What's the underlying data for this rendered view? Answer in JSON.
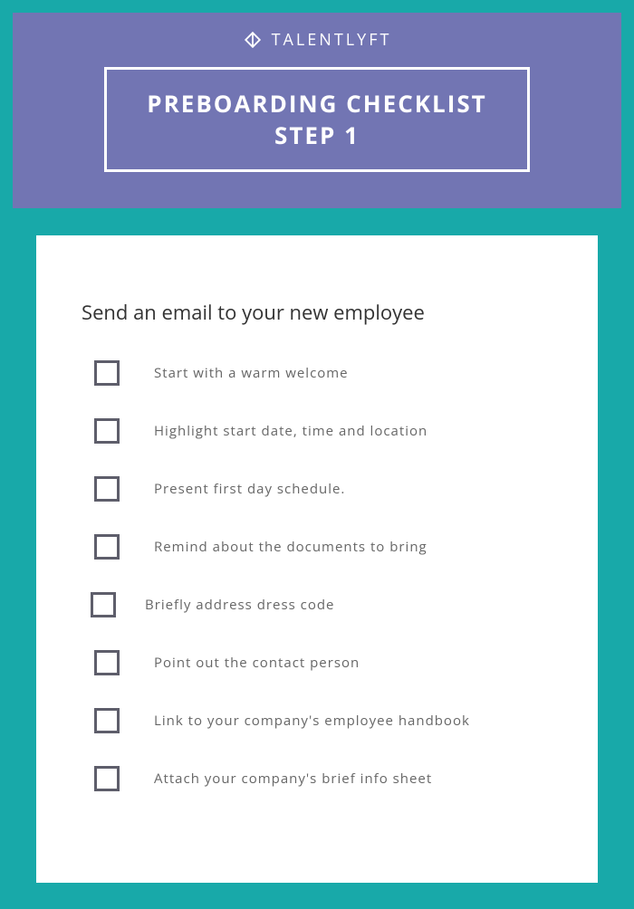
{
  "brand": {
    "name": "TalentLyft"
  },
  "header": {
    "title_line1": "PREBOARDING CHECKLIST",
    "title_line2": "STEP 1"
  },
  "section": {
    "title": "Send an email to your new employee"
  },
  "checklist": [
    {
      "label": "Start with a warm welcome"
    },
    {
      "label": "Highlight start date, time and location"
    },
    {
      "label": "Present first day schedule."
    },
    {
      "label": "Remind about the documents to bring"
    },
    {
      "label": "Briefly address dress code"
    },
    {
      "label": "Point out the contact person"
    },
    {
      "label": "Link to your company's employee handbook"
    },
    {
      "label": "Attach your company's brief info sheet"
    }
  ]
}
